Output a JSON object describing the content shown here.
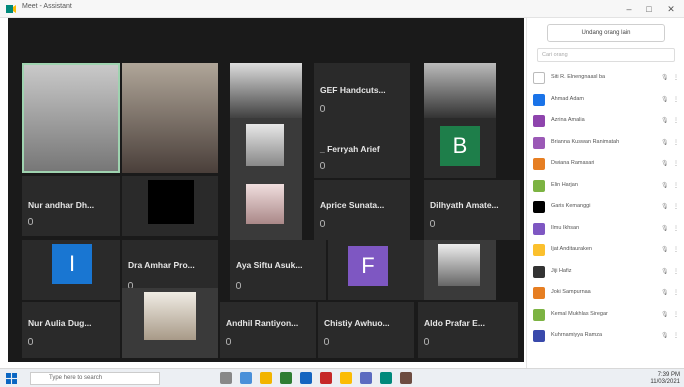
{
  "window": {
    "title": "Meet - Assistant"
  },
  "participants_tiles": [
    {
      "name": "GEF Handcuts...",
      "initial": ""
    },
    {
      "name": "Nur andhar Dh...",
      "initial": ""
    },
    {
      "name": "_ Ferryah Arief",
      "initial": "B"
    },
    {
      "name": "Aprice Sunata...",
      "initial": ""
    },
    {
      "name": "Dilhyath Amate...",
      "initial": ""
    },
    {
      "name": "Dra Amhar Pro...",
      "initial": ""
    },
    {
      "name": "Aya Siftu Asuk...",
      "initial": "F"
    },
    {
      "name": "Nur Aulia Dug...",
      "initial": ""
    },
    {
      "name": "Andhil Rantiyon...",
      "initial": ""
    },
    {
      "name": "Chistiy Awhuo...",
      "initial": ""
    },
    {
      "name": "Aldo Prafar E...",
      "initial": ""
    },
    {
      "name": "",
      "initial": "I"
    }
  ],
  "panel": {
    "invite_label": "Undang orang lain",
    "search_placeholder": "Cari orang",
    "people": [
      {
        "name": "Siti R. Elnengnaasl ba",
        "color": "#ffffff"
      },
      {
        "name": "Ahmad Adam",
        "color": "#1a73e8"
      },
      {
        "name": "Azrina Amalia",
        "color": "#8e44ad"
      },
      {
        "name": "Brianna Kuswan Ranimatah",
        "color": "#9b59b6"
      },
      {
        "name": "Dwiana Ramasari",
        "color": "#e67e22"
      },
      {
        "name": "Elin Harjan",
        "color": "#7cb342"
      },
      {
        "name": "Garis Kemanggi",
        "color": "#000000"
      },
      {
        "name": "Ilmu Ikhsan",
        "color": "#7e57c2"
      },
      {
        "name": "Ijat Anditauraken",
        "color": "#fbc02d"
      },
      {
        "name": "Jiji Hafiz",
        "color": "#333333"
      },
      {
        "name": "Joki Sampurnaa",
        "color": "#e67e22"
      },
      {
        "name": "Kemal Mukhlas Siregar",
        "color": "#7cb342"
      },
      {
        "name": "Kuhrnamiyya Ramza",
        "color": "#3949ab"
      }
    ]
  },
  "taskbar": {
    "search_text": "Type here to search",
    "time": "7:39 PM",
    "date": "11/03/2021"
  }
}
